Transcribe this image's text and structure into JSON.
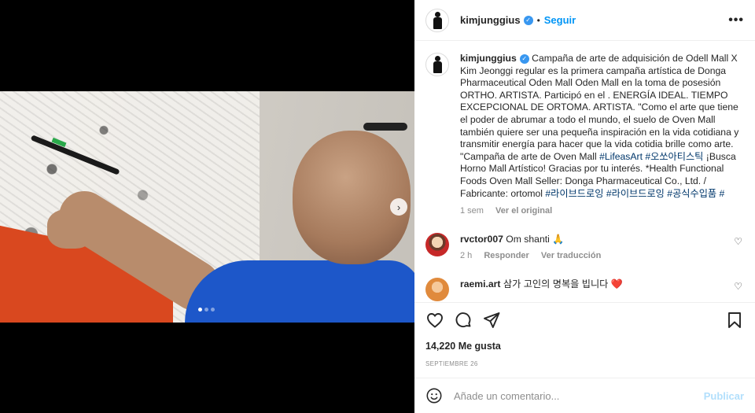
{
  "post": {
    "username": "kimjunggius",
    "follow_label": "Seguir",
    "more_label": "•••",
    "dot": "•",
    "carousel": {
      "slide_count": 3,
      "active_index": 0,
      "next_icon": "chevron-right-icon"
    }
  },
  "caption": {
    "username": "kimjunggius",
    "text_1": "Campaña de arte de adquisición de Odell Mall X Kim Jeonggi regular es la primera campaña artística de Donga Pharmaceutical Oden Mall Oden Mall en la toma de posesión ORTHO. ARTISTA. Participó en el . ENERGÍA IDEAL. TIEMPO EXCEPCIONAL DE ORTOMA. ARTISTA. \"Como el arte que tiene el poder de abrumar a todo el mundo, el suelo de Oven Mall también quiere ser una pequeña inspiración en la vida cotidiana y transmitir energía para hacer que la vida cotidia brille como arte. \"Campaña de arte de Oven Mall ",
    "hashtag_1": "#LifeasArt",
    "hashtag_2": "#오쏘아티스틱",
    "text_2": " ¡Busca Horno Mall Artístico! Gracias por tu interés. *Health Functional Foods Oven Mall Seller: Donga Pharmaceutical Co., Ltd. / Fabricante: ortomol ",
    "hashtag_3": "#라이브드로잉",
    "hashtag_4": "#라이브드로잉",
    "hashtag_5": "#공식수입품",
    "hashtag_6": "#",
    "time": "1 sem",
    "see_original": "Ver el original"
  },
  "comments": [
    {
      "username": "rvctor007",
      "text": "Om shanti 🙏",
      "time": "2 h",
      "reply": "Responder",
      "translate": "Ver traducción"
    },
    {
      "username": "raemi.art",
      "text": "삼가 고인의 명복을 빕니다 ❤️"
    }
  ],
  "actions": {
    "like_icon": "heart-icon",
    "comment_icon": "comment-icon",
    "share_icon": "share-icon",
    "save_icon": "bookmark-icon",
    "likes": "14,220 Me gusta",
    "date": "SEPTIEMBRE 26"
  },
  "add_comment": {
    "placeholder": "Añade un comentario...",
    "publish": "Publicar"
  },
  "colors": {
    "accent": "#0095f6",
    "hashtag": "#00376b",
    "muted": "#8e8e8e",
    "publish_disabled": "#b2dffc"
  }
}
